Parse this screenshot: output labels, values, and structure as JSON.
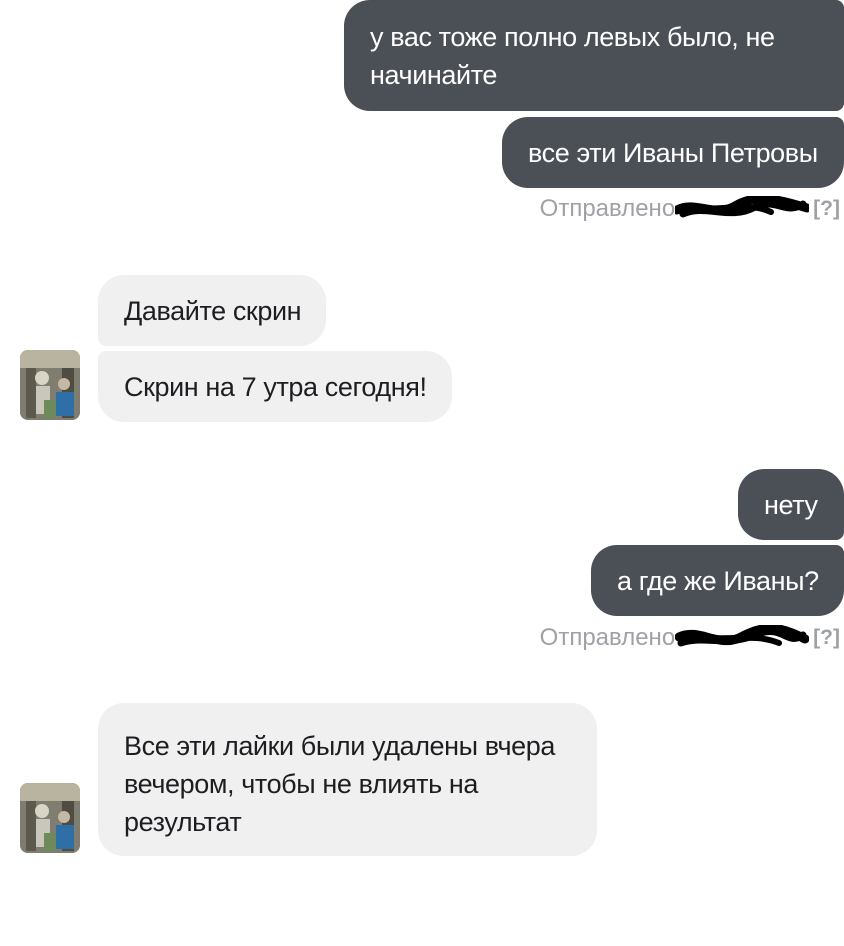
{
  "messages": {
    "m1": "у вас тоже полно левых было, не начинайте",
    "m2": "все эти Иваны Петровы",
    "status1_prefix": "Отправлено",
    "status1_help": "[?]",
    "m3": "Давайте скрин",
    "m4": "Скрин на 7 утра сегодня!",
    "m5": "нету",
    "m6": "а где же Иваны?",
    "status2_prefix": "Отправлено",
    "status2_help": "[?]",
    "m7": "Все эти лайки были удалены вчера вечером, чтобы не влиять на результат"
  },
  "colors": {
    "outgoing_bubble": "#4b4f56",
    "incoming_bubble": "#f1f0f0",
    "status_text": "#9ea1a6"
  },
  "icons": {
    "avatar": "user-avatar-photo",
    "redaction": "black-scribble-redaction"
  }
}
